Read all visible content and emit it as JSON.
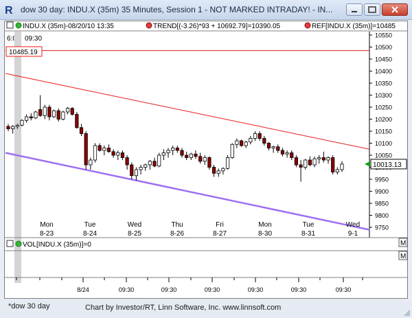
{
  "window": {
    "title": "dow 30 day: INDU.X (35m) 35 Minutes, Session 1 - NOT MARKED INTRADAY! - IN..."
  },
  "legend": {
    "symbol": "INDU.X (35m)-08/20/10 13:35",
    "trend": "TREND[(-3.26)*93 + 10692.79]=10390.05",
    "ref": "REF[INDU.X (35m)]=10485",
    "time_left": "6:02",
    "time_right": "09:30"
  },
  "ref_label": "10485.19",
  "last_price_label": "10013.13",
  "volume_legend": "VOL[INDU.X (35m)]=0",
  "m_button": "M",
  "day_labels": [
    {
      "day": "Mon",
      "date": "8-23"
    },
    {
      "day": "Tue",
      "date": "8-24"
    },
    {
      "day": "Wed",
      "date": "8-25"
    },
    {
      "day": "Thu",
      "date": "8-26"
    },
    {
      "day": "Fri",
      "date": "8-27"
    },
    {
      "day": "Mon",
      "date": "8-30"
    },
    {
      "day": "Tue",
      "date": "8-31"
    },
    {
      "day": "Wed",
      "date": "9-1"
    }
  ],
  "time_axis_labels": [
    "8/24",
    "09:30",
    "09:30",
    "09:30",
    "09:30",
    "09:30",
    "09:30",
    "09:30"
  ],
  "footer": {
    "tab": "*dow 30 day",
    "credit": "Chart by Investor/RT, Linn Software, Inc. www.linnsoft.com"
  },
  "colors": {
    "ref_line": "#e8191a",
    "upper_trend": "#e8191a",
    "lower_trend": "#9d6ff1",
    "down_candle": "#8b0000",
    "up_candle": "#ffffff",
    "last_marker": "#13a013"
  },
  "chart_data": {
    "type": "candlestick",
    "y_axis": {
      "min": 9750,
      "max": 10550,
      "step": 50,
      "tick_labels": [
        "10550",
        "10500",
        "10450",
        "10400",
        "10350",
        "10300",
        "10250",
        "10200",
        "10150",
        "10100",
        "10050",
        "10000",
        "9950",
        "9900",
        "9850",
        "9800",
        "9750"
      ]
    },
    "reference_level": 10485.19,
    "last_price": 10013.13,
    "upper_trendline": {
      "start": 10390,
      "end": 10075
    },
    "lower_trendline": {
      "start": 10060,
      "end": 9740
    },
    "candles": [
      [
        10170,
        10180,
        10150,
        10160
      ],
      [
        10160,
        10175,
        10140,
        10170
      ],
      [
        10170,
        10180,
        10160,
        10175
      ],
      [
        10175,
        10200,
        10170,
        10195
      ],
      [
        10195,
        10220,
        10185,
        10210
      ],
      [
        10210,
        10225,
        10195,
        10205
      ],
      [
        10205,
        10235,
        10200,
        10230
      ],
      [
        10240,
        10300,
        10210,
        10215
      ],
      [
        10215,
        10260,
        10200,
        10250
      ],
      [
        10250,
        10260,
        10195,
        10210
      ],
      [
        10210,
        10240,
        10205,
        10235
      ],
      [
        10235,
        10245,
        10190,
        10200
      ],
      [
        10200,
        10235,
        10195,
        10230
      ],
      [
        10230,
        10250,
        10220,
        10245
      ],
      [
        10245,
        10250,
        10215,
        10220
      ],
      [
        10220,
        10230,
        10160,
        10165
      ],
      [
        10165,
        10180,
        10130,
        10140
      ],
      [
        10140,
        10150,
        9990,
        10010
      ],
      [
        10010,
        10040,
        9990,
        10030
      ],
      [
        10030,
        10100,
        10020,
        10090
      ],
      [
        10090,
        10100,
        10065,
        10070
      ],
      [
        10070,
        10090,
        10050,
        10080
      ],
      [
        10080,
        10095,
        10060,
        10065
      ],
      [
        10065,
        10075,
        10040,
        10050
      ],
      [
        10050,
        10070,
        10030,
        10060
      ],
      [
        10060,
        10070,
        10030,
        10040
      ],
      [
        10040,
        10050,
        9990,
        10010
      ],
      [
        10010,
        10020,
        9950,
        9965
      ],
      [
        9965,
        10000,
        9945,
        9990
      ],
      [
        9990,
        10010,
        9970,
        10000
      ],
      [
        10000,
        10015,
        9985,
        10010
      ],
      [
        10010,
        10030,
        9990,
        10025
      ],
      [
        10025,
        10040,
        10000,
        10005
      ],
      [
        10005,
        10060,
        10000,
        10050
      ],
      [
        10050,
        10075,
        10030,
        10060
      ],
      [
        10060,
        10080,
        10040,
        10070
      ],
      [
        10070,
        10090,
        10050,
        10080
      ],
      [
        10080,
        10090,
        10060,
        10070
      ],
      [
        10070,
        10080,
        10040,
        10050
      ],
      [
        10050,
        10065,
        10030,
        10040
      ],
      [
        10040,
        10060,
        10030,
        10055
      ],
      [
        10055,
        10070,
        10035,
        10045
      ],
      [
        10045,
        10060,
        10015,
        10025
      ],
      [
        10025,
        10050,
        10010,
        10040
      ],
      [
        10040,
        10045,
        9990,
        10000
      ],
      [
        10000,
        10010,
        9960,
        9975
      ],
      [
        9975,
        9995,
        9960,
        9985
      ],
      [
        9985,
        10000,
        9970,
        9995
      ],
      [
        9995,
        10050,
        9990,
        10040
      ],
      [
        10040,
        10100,
        10035,
        10095
      ],
      [
        10095,
        10120,
        10080,
        10110
      ],
      [
        10110,
        10115,
        10085,
        10090
      ],
      [
        10090,
        10110,
        10080,
        10105
      ],
      [
        10105,
        10130,
        10095,
        10120
      ],
      [
        10120,
        10150,
        10110,
        10140
      ],
      [
        10140,
        10150,
        10110,
        10120
      ],
      [
        10120,
        10130,
        10090,
        10100
      ],
      [
        10100,
        10105,
        10070,
        10080
      ],
      [
        10080,
        10090,
        10060,
        10085
      ],
      [
        10085,
        10095,
        10060,
        10070
      ],
      [
        10070,
        10080,
        10045,
        10055
      ],
      [
        10055,
        10070,
        10040,
        10060
      ],
      [
        10060,
        10070,
        10030,
        10040
      ],
      [
        10040,
        10050,
        10000,
        10010
      ],
      [
        10010,
        10030,
        9940,
        10000
      ],
      [
        10000,
        10035,
        9990,
        10030
      ],
      [
        10030,
        10045,
        10005,
        10010
      ],
      [
        10010,
        10045,
        10000,
        10035
      ],
      [
        10035,
        10050,
        10015,
        10040
      ],
      [
        10040,
        10065,
        10020,
        10030
      ],
      [
        10030,
        10045,
        10015,
        10040
      ],
      [
        10040,
        10050,
        9970,
        9980
      ],
      [
        9980,
        10000,
        9970,
        9990
      ],
      [
        9990,
        10025,
        9980,
        10013
      ]
    ]
  }
}
